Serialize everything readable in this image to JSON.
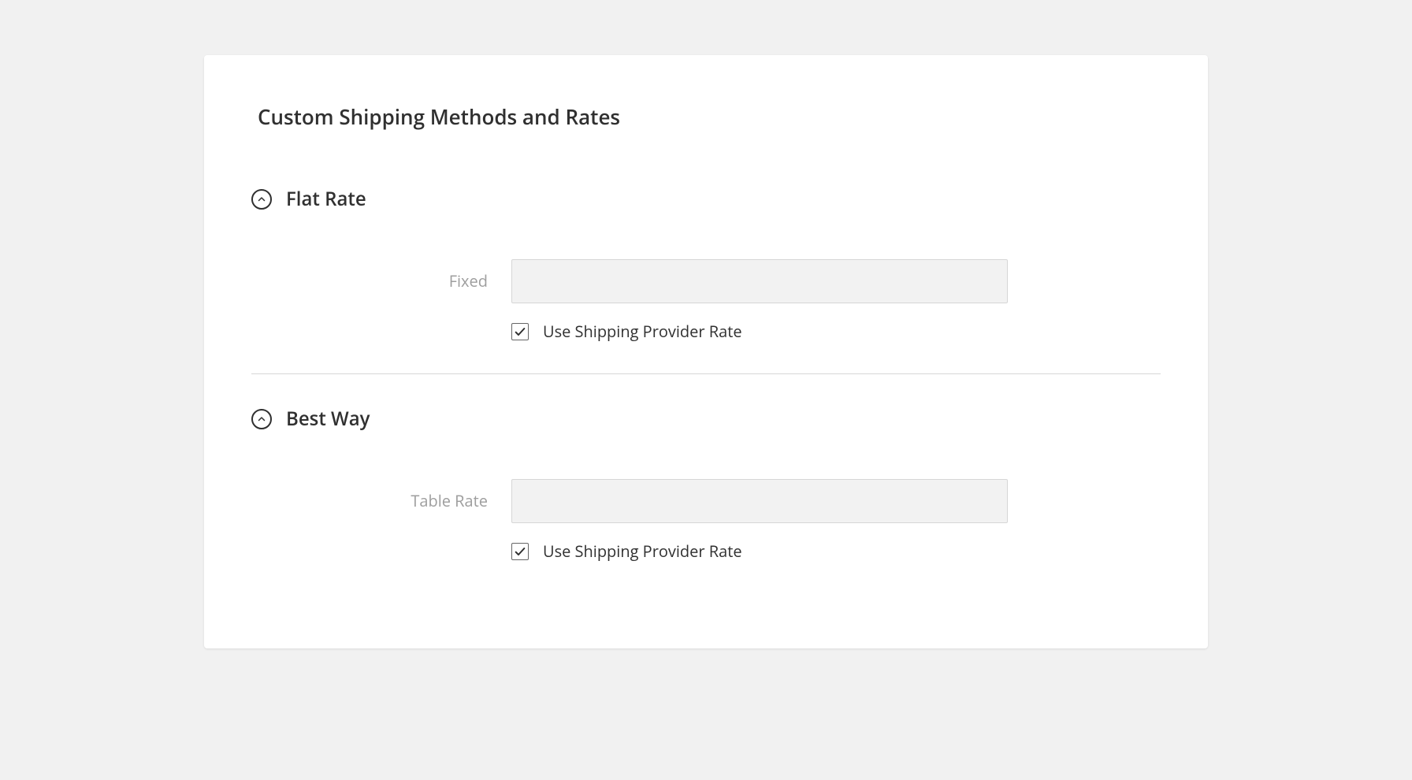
{
  "panel": {
    "title": "Custom Shipping Methods and Rates"
  },
  "sections": {
    "flat_rate": {
      "title": "Flat Rate",
      "field_label": "Fixed",
      "field_value": "",
      "checkbox_label": "Use Shipping Provider Rate",
      "checkbox_checked": true
    },
    "best_way": {
      "title": "Best Way",
      "field_label": "Table Rate",
      "field_value": "",
      "checkbox_label": "Use Shipping Provider Rate",
      "checkbox_checked": true
    }
  }
}
